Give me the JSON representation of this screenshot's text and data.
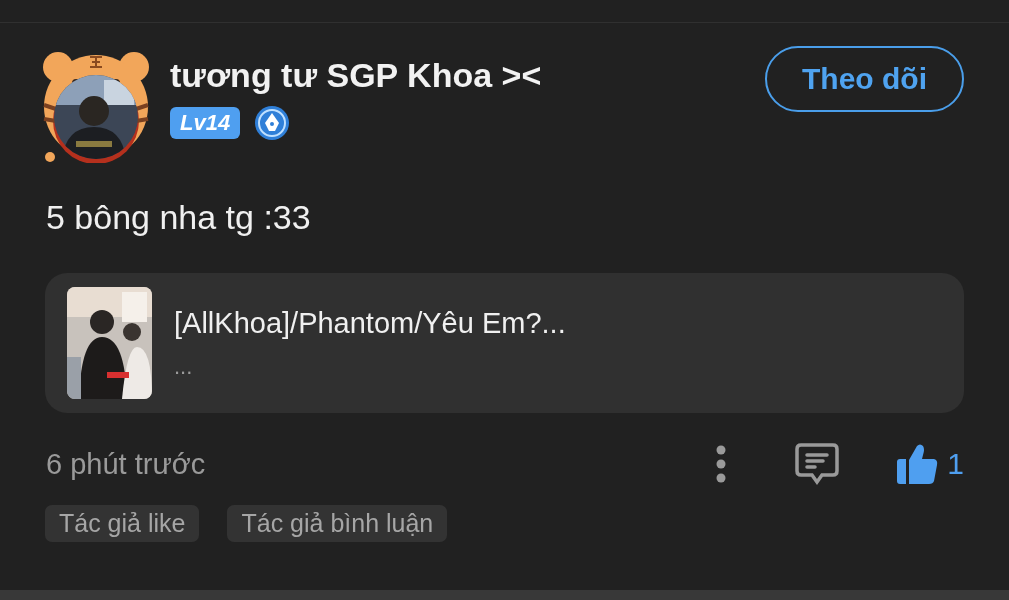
{
  "post": {
    "author": {
      "name": "tương tư SGP Khoa ><",
      "level_badge": "Lv14"
    },
    "follow_button": "Theo dõi",
    "text": "5 bông nha tg :33",
    "attachment": {
      "title": "[AllKhoa]/Phantom/Yêu Em?...",
      "subtitle": "..."
    },
    "time": "6 phút trước",
    "like_count": "1",
    "liked": true,
    "tags": [
      "Tác giả like",
      "Tác giả bình luận"
    ]
  }
}
